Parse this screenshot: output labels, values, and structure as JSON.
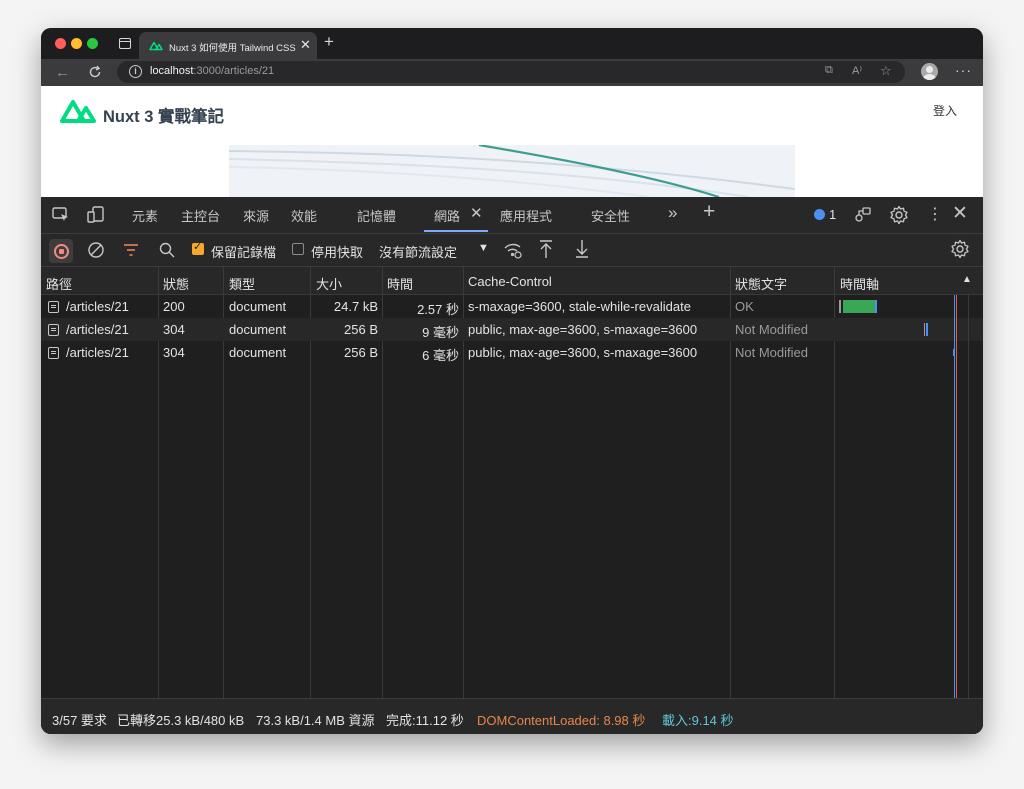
{
  "browser": {
    "tab_title": "Nuxt 3 如何使用 Tailwind CSS",
    "url_host": "localhost",
    "url_path": ":3000/articles/21"
  },
  "page": {
    "site_name": "Nuxt 3 實戰筆記",
    "login_label": "登入"
  },
  "devtools": {
    "tabs": [
      "元素",
      "主控台",
      "來源",
      "效能",
      "記憶體",
      "網路",
      "應用程式",
      "安全性"
    ],
    "active_tab": "網路",
    "issues_count": "1",
    "toolbar": {
      "preserve_log": "保留記錄檔",
      "disable_cache": "停用快取",
      "throttling": "沒有節流設定"
    },
    "columns": [
      "路徑",
      "狀態",
      "類型",
      "大小",
      "時間",
      "Cache-Control",
      "狀態文字",
      "時間軸"
    ],
    "rows": [
      {
        "path": "/articles/21",
        "status": "200",
        "type": "document",
        "size": "24.7 kB",
        "time": "2.57 秒",
        "cache_control": "s-maxage=3600, stale-while-revalidate",
        "status_text": "OK"
      },
      {
        "path": "/articles/21",
        "status": "304",
        "type": "document",
        "size": "256 B",
        "time": "9 毫秒",
        "cache_control": "public, max-age=3600, s-maxage=3600",
        "status_text": "Not Modified"
      },
      {
        "path": "/articles/21",
        "status": "304",
        "type": "document",
        "size": "256 B",
        "time": "6 毫秒",
        "cache_control": "public, max-age=3600, s-maxage=3600",
        "status_text": "Not Modified"
      }
    ],
    "status_bar": {
      "requests": "3/57 要求",
      "transferred": "已轉移25.3 kB/480 kB",
      "resources": "73.3 kB/1.4 MB 資源",
      "finish": "完成:11.12 秒",
      "dom_content_loaded": "DOMContentLoaded: 8.98 秒",
      "load": "載入:9.14 秒"
    }
  },
  "colors": {
    "dom_content_loaded": "#e8864a",
    "load": "#5fc7d8",
    "nuxt_green": "#00dc82",
    "waterfall_green": "#3aa757",
    "waterfall_blue": "#4f8ef2"
  }
}
